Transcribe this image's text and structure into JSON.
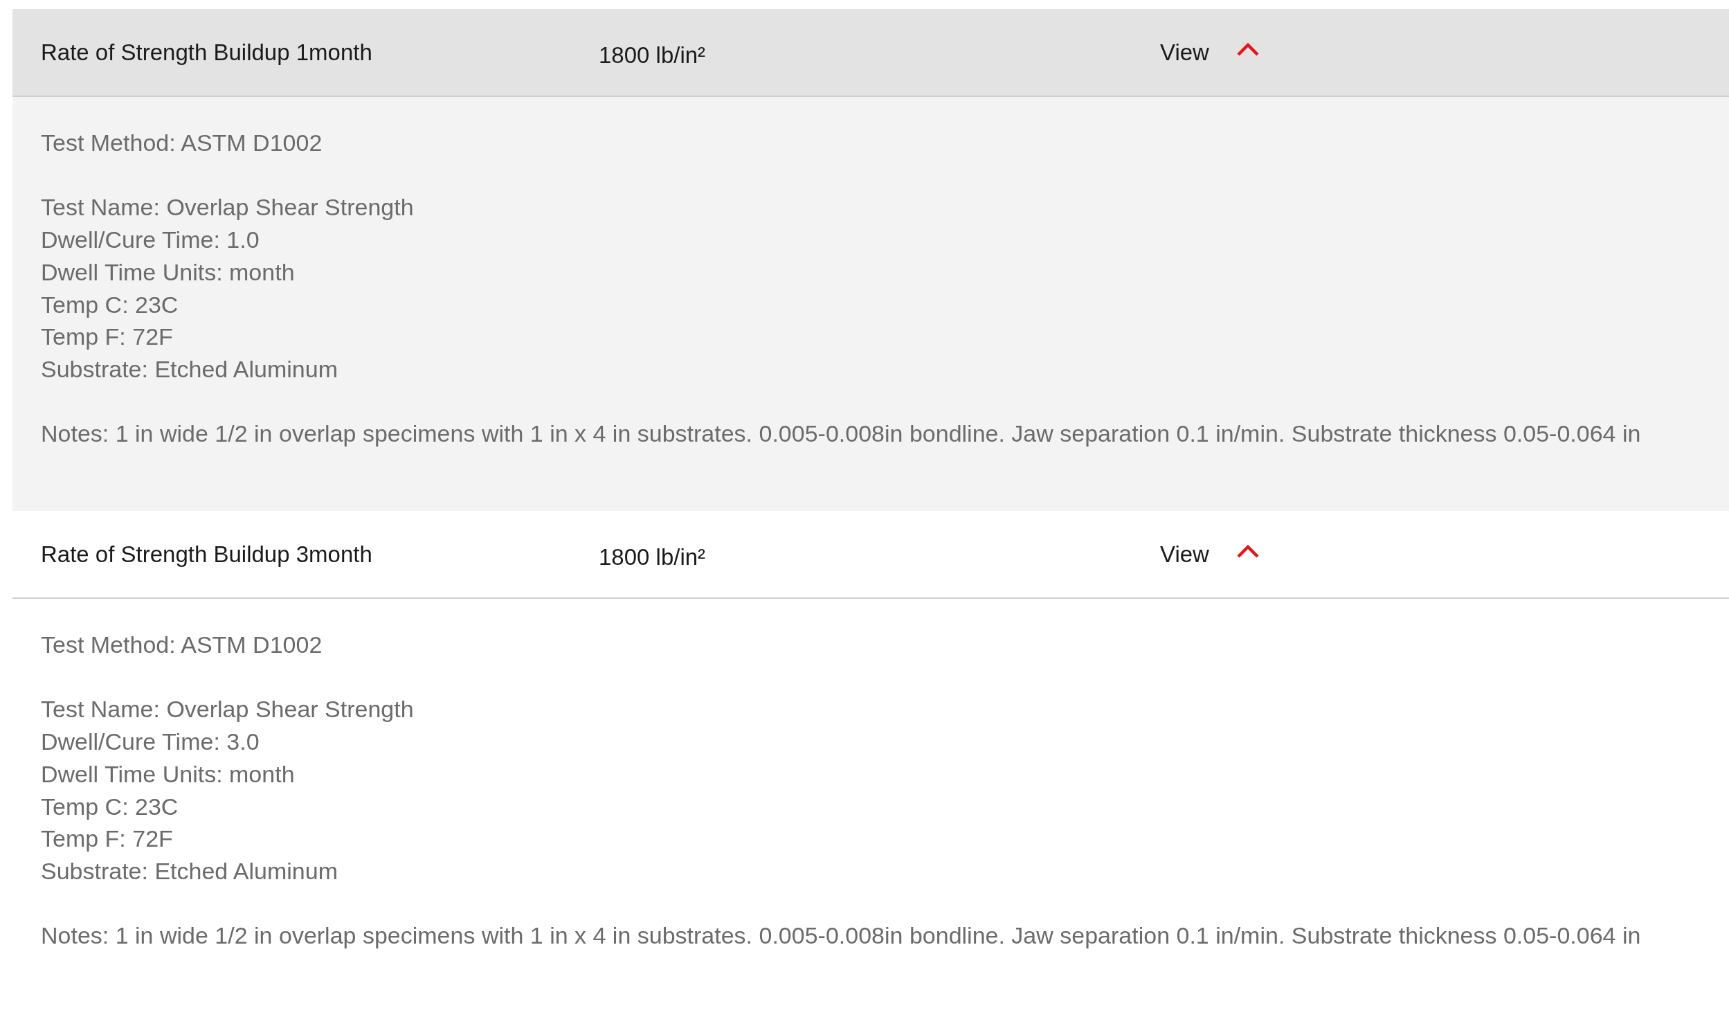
{
  "rows": [
    {
      "name": "Rate of Strength Buildup 1month",
      "value": "1800 lb/in²",
      "toggle": "View",
      "expanded": true,
      "highlighted": true,
      "details": [
        [
          "Test Method: ASTM D1002"
        ],
        [
          "Test Name: Overlap Shear Strength",
          "Dwell/Cure Time: 1.0",
          "Dwell Time Units: month",
          "Temp C: 23C",
          "Temp F: 72F",
          "Substrate: Etched Aluminum"
        ],
        [
          "Notes: 1 in wide 1/2 in overlap specimens with 1 in x 4 in substrates. 0.005-0.008in bondline. Jaw separation 0.1 in/min. Substrate thickness 0.05-0.064 in"
        ]
      ]
    },
    {
      "name": "Rate of Strength Buildup 3month",
      "value": "1800 lb/in²",
      "toggle": "View",
      "expanded": true,
      "highlighted": false,
      "details": [
        [
          "Test Method: ASTM D1002"
        ],
        [
          "Test Name: Overlap Shear Strength",
          "Dwell/Cure Time: 3.0",
          "Dwell Time Units: month",
          "Temp C: 23C",
          "Temp F: 72F",
          "Substrate: Etched Aluminum"
        ],
        [
          "Notes: 1 in wide 1/2 in overlap specimens with 1 in x 4 in substrates. 0.005-0.008in bondline. Jaw separation 0.1 in/min. Substrate thickness 0.05-0.064 in"
        ]
      ]
    }
  ]
}
